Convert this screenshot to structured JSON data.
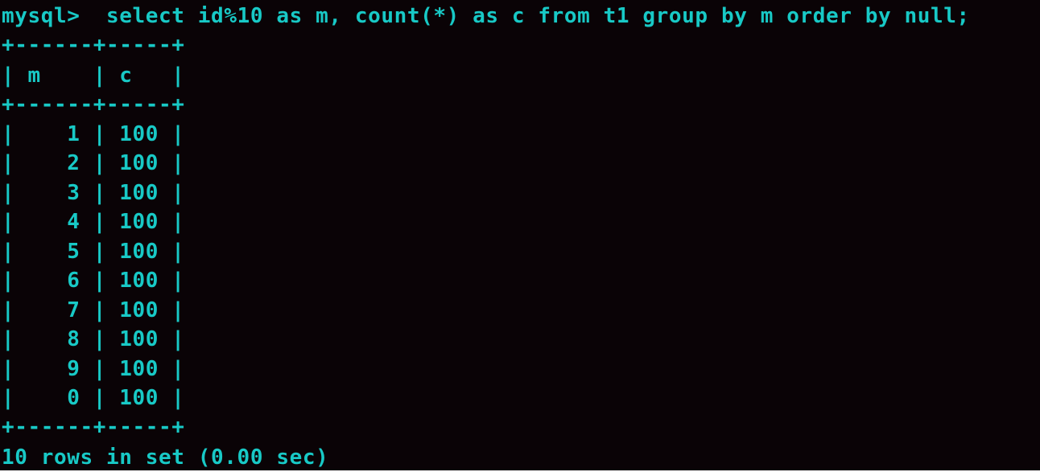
{
  "colors": {
    "background": "#0a0306",
    "foreground": "#18c9c6"
  },
  "terminal": {
    "prompt": "mysql> ",
    "command": " select id%10 as m, count(*) as c from t1 group by m order by null;",
    "table": {
      "border": "+------+-----+",
      "header_row": "| m    | c   |",
      "rows": [
        "|    1 | 100 |",
        "|    2 | 100 |",
        "|    3 | 100 |",
        "|    4 | 100 |",
        "|    5 | 100 |",
        "|    6 | 100 |",
        "|    7 | 100 |",
        "|    8 | 100 |",
        "|    9 | 100 |",
        "|    0 | 100 |"
      ]
    },
    "status": "10 rows in set (0.00 sec)"
  }
}
